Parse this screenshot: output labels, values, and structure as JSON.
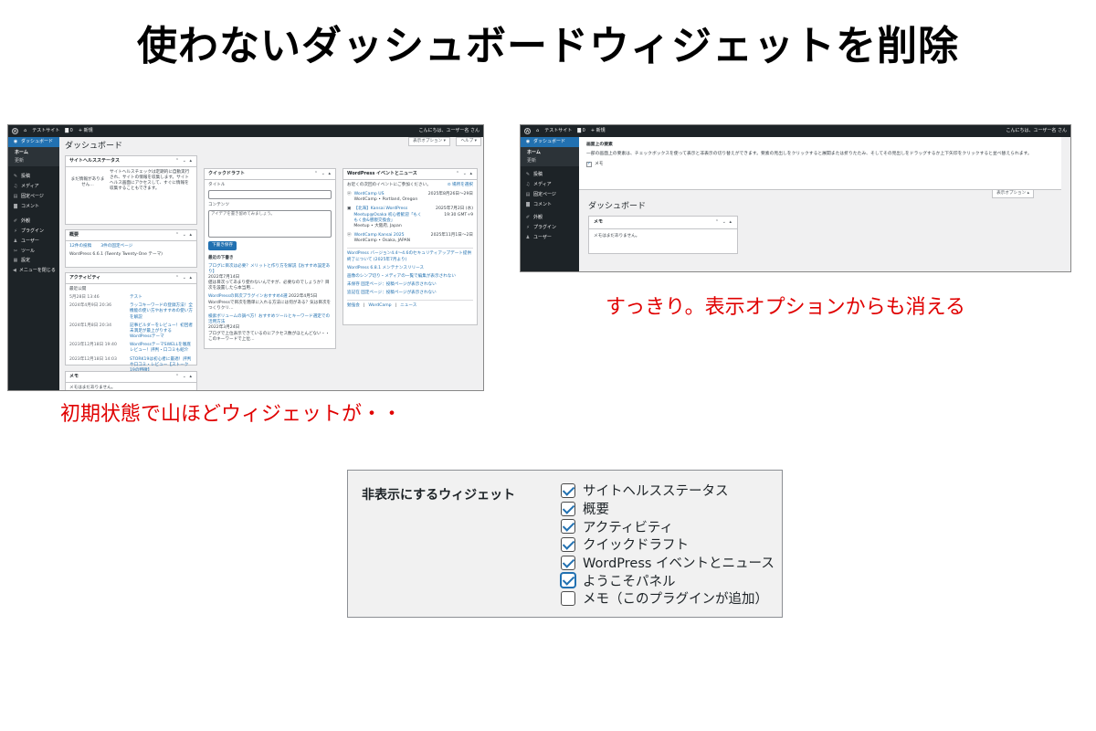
{
  "title": "使わないダッシュボードウィジェットを削除",
  "captions": {
    "left": "初期状態で山ほどウィジェットが・・",
    "right": "すっきり。表示オプションからも消える"
  },
  "before": {
    "adminbar": {
      "site": "テストサイト",
      "comments": "0",
      "new": "+ 新規",
      "greeting": "こんにちは、ユーザー名 さん"
    },
    "menu": {
      "dashboard": "ダッシュボード",
      "sub": [
        "ホーム",
        "更新"
      ],
      "items": [
        "投稿",
        "メディア",
        "固定ページ",
        "コメント",
        "外観",
        "プラグイン",
        "ユーザー",
        "ツール",
        "設定",
        "メニューを閉じる"
      ]
    },
    "page_title": "ダッシュボード",
    "screen_options": "表示オプション ▾",
    "help": "ヘルプ ▾",
    "site_health": {
      "title": "サイトヘルスステータス",
      "left": "まだ情報がありません…",
      "right": "サイトヘルスチェックは定期的に自動実行され、サイトの情報を収集します。サイトヘルス画面にアクセスして、すぐに情報を収集することもできます。"
    },
    "glance": {
      "title": "概要",
      "posts": "12件の投稿",
      "pages": "3件の固定ページ",
      "version": "WordPress 6.6.1 (Twenty Twenty-One テーマ)"
    },
    "activity": {
      "title": "アクティビティ",
      "sub": "最近公開",
      "rows": [
        {
          "date": "5月28日 13:46",
          "text": "テスト"
        },
        {
          "date": "2024年4月9日 20:36",
          "text": "ラッコキーワードの登録方法！全機能の使い方やおすすめの使い方を解説"
        },
        {
          "date": "2024年1月8日 20:34",
          "text": "記事ビルダーをレビュー！初回者未満足が最上がりするWordPressテーマ"
        },
        {
          "date": "2023年12月18日 19:40",
          "text": "WordPressテーマSWELLを徹底レビュー！評判・口コミも紹介"
        },
        {
          "date": "2023年12月18日 14:03",
          "text": "STORK19は初心者に最適！評判や口コミ・レビュー【ストーク19の特徴】"
        }
      ]
    },
    "memo": {
      "title": "メモ",
      "body": "メモはまだありません。"
    },
    "quickdraft": {
      "title": "クイックドラフト",
      "title_label": "タイトル",
      "content_label": "コンテンツ",
      "placeholder": "アイデアを書き留めてみましょう。",
      "save": "下書き保存",
      "recent": "最近の下書き",
      "drafts": [
        {
          "link": "ブログに目次は必要？メリットと作り方を解説【おすすめ設定あり】",
          "date": "2022年7月14日",
          "text": "値は目次ってあまり使わないんですが、必要なのでしょうか？目次を設置したら本当用…"
        },
        {
          "link": "WordPressの目次プラグインおすすめ4選",
          "date": "2022年4月5日",
          "text": "WordPressで目次を簡単に入れる方法には何がある？気は目次をつくりクリ…"
        },
        {
          "link": "検索ボリュームの調べ方！おすすめツールとキーワード選定での活用方法",
          "date": "2022年3月24日",
          "text": "ブログで上位表示できているのにアクセス数がほとんどない・・ このキーワードで上位…"
        }
      ]
    },
    "events": {
      "title": "WordPress イベントとニュース",
      "intro": "お近くの次回のイベントにご参加ください。",
      "loc": "場所を選択",
      "list": [
        {
          "name": "WordCamp US",
          "sub": "WordCamp • Portland, Oregon",
          "date": "2025年8月26日〜29日"
        },
        {
          "name": "【北海】Kansai WordPress Meetup@Osaka 初心者歓迎「もくもく会&懇親交換会」",
          "sub": "Meetup • 大阪府, Japan",
          "date": "2025年7月2日 (水) 19:30 GMT+9"
        },
        {
          "name": "WordCamp Kansai 2025",
          "sub": "WordCamp • Osaka, JAPAN",
          "date": "2025年11月1日〜2日"
        }
      ],
      "news": [
        "WordPress バージョン4.4〜4.6のセキュリティアップデート提供終了について (2025年7月より)",
        "WordPress 6.8.1 メンテナンスリリース",
        "画像のシンプ切り・メディアの一覧で編集が表示されない",
        "未保存 固定ページ：投稿ページが表示されない",
        "追記在 固定ページ：投稿ページが表示されない"
      ],
      "footer": [
        "勉強会",
        "WordCamp",
        "ニュース"
      ]
    }
  },
  "after": {
    "panel_title": "画面上の要素",
    "panel_desc": "一部の画面上の要素は、チェックボックスを使って表示と非表示の切り替えができます。要素の見出しをクリックすると展開または折りたたみ、そしてその見出しをドラッグするか上下矢印をクリックすると並べ替えられます。",
    "panel_check": "メモ",
    "screen_options": "表示オプション ▴",
    "page_title": "ダッシュボード",
    "memo": {
      "title": "メモ",
      "body": "メモはまだありません。"
    },
    "menu": {
      "dashboard": "ダッシュボード",
      "sub": [
        "ホーム",
        "更新"
      ],
      "items": [
        "投稿",
        "メディア",
        "固定ページ",
        "コメント",
        "外観",
        "プラグイン",
        "ユーザー"
      ]
    }
  },
  "hide_panel": {
    "label": "非表示にするウィジェット",
    "options": [
      {
        "label": "サイトヘルスステータス",
        "checked": true
      },
      {
        "label": "概要",
        "checked": true
      },
      {
        "label": "アクティビティ",
        "checked": true
      },
      {
        "label": "クイックドラフト",
        "checked": true
      },
      {
        "label": "WordPress イベントとニュース",
        "checked": true
      },
      {
        "label": "ようこそパネル",
        "checked": true
      },
      {
        "label": "メモ（このプラグインが追加）",
        "checked": false
      }
    ]
  }
}
